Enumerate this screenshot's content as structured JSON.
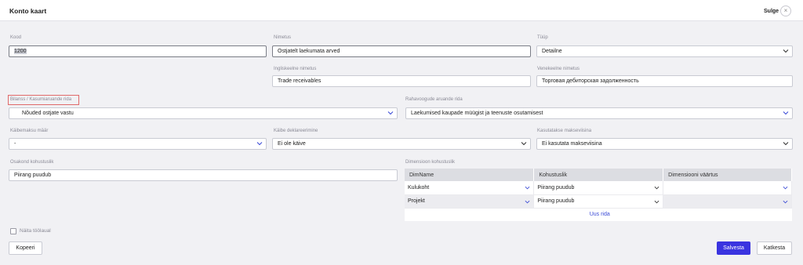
{
  "header": {
    "title": "Konto kaart",
    "close_label": "Sulge",
    "close_icon": "×"
  },
  "fields": {
    "kood": {
      "label": "Kood",
      "value": "1200"
    },
    "nimetus": {
      "label": "Nimetus",
      "value": "Ostjatelt laekumata arved"
    },
    "tyyp": {
      "label": "Tüüp",
      "value": "Detailne"
    },
    "inglise": {
      "label": "Ingliskeelne nimetus",
      "value": "Trade receivables"
    },
    "vene": {
      "label": "Venekeelne nimetus",
      "value": "Торговая дебиторская задолженность"
    },
    "bilanss": {
      "label": "Bilanss / Kasumiaruande rida",
      "value": "Nõuded ostjate vastu"
    },
    "rahavoog": {
      "label": "Rahavoogude aruande rida",
      "value": "Laekumised kaupade müügist ja teenuste osutamisest"
    },
    "kaibemaks": {
      "label": "Käibemaksu määr",
      "value": "-"
    },
    "kaibe_dekl": {
      "label": "Käibe deklareerimine",
      "value": "Ei ole käive"
    },
    "maksevii": {
      "label": "Kasutatakse makseviisina",
      "value": "Ei kasutata makseviisina"
    },
    "osakond": {
      "label": "Osakond kohustuslik",
      "value": "Piirang puudub"
    }
  },
  "dimensions": {
    "label": "Dimensioon kohustuslik",
    "columns": [
      "DimName",
      "Kohustuslik",
      "Dimensiooni väärtus"
    ],
    "rows": [
      {
        "dim": "Kulukoht",
        "req": "Piirang puudub",
        "val": ""
      },
      {
        "dim": "Projekt",
        "req": "Piirang puudub",
        "val": ""
      }
    ],
    "add_row": "Uus rida"
  },
  "footer": {
    "checkbox_label": "Näita töölaual",
    "copy_button": "Kopeeri",
    "save_button": "Salvesta",
    "cancel_button": "Katkesta"
  },
  "colors": {
    "primary": "#3a34e0",
    "chevron": "#3a4ad6",
    "highlight": "#e06a6a"
  }
}
